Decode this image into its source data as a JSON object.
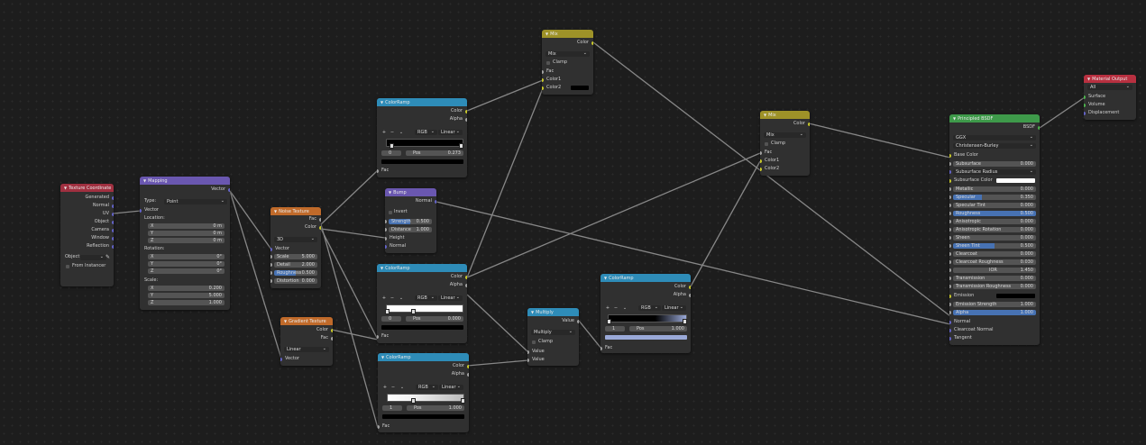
{
  "colors": {
    "texcoord": "#a03040",
    "mapping": "#6a57b0",
    "texture": "#c06a2a",
    "converter": "#2e8cb8",
    "shader": "#3e9a4a",
    "output": "#b83040",
    "bump": "#6a57b0"
  },
  "nodes": {
    "texcoord": {
      "title": "Texture Coordinate",
      "outputs": [
        "Generated",
        "Normal",
        "UV",
        "Object",
        "Camera",
        "Window",
        "Reflection"
      ],
      "object_label": "Object",
      "from_instancer": "From Instancer"
    },
    "mapping": {
      "title": "Mapping",
      "out": "Vector",
      "type_label": "Type:",
      "type_value": "Point",
      "vector_in": "Vector",
      "location_label": "Location:",
      "rotation_label": "Rotation:",
      "scale_label": "Scale:",
      "location": [
        [
          "X",
          "0 m"
        ],
        [
          "Y",
          "0 m"
        ],
        [
          "Z",
          "0 m"
        ]
      ],
      "rotation": [
        [
          "X",
          "0°"
        ],
        [
          "Y",
          "0°"
        ],
        [
          "Z",
          "0°"
        ]
      ],
      "scale": [
        [
          "X",
          "0.200"
        ],
        [
          "Y",
          "5.000"
        ],
        [
          "Z",
          "1.000"
        ]
      ]
    },
    "noise": {
      "title": "Noise Texture",
      "out_fac": "Fac",
      "out_color": "Color",
      "dim": "3D",
      "vector_in": "Vector",
      "fields": [
        [
          "Scale",
          "5.000"
        ],
        [
          "Detail",
          "2.000"
        ],
        [
          "Roughness",
          "0.500"
        ],
        [
          "Distortion",
          "0.000"
        ]
      ]
    },
    "gradient": {
      "title": "Gradient Texture",
      "out_color": "Color",
      "out_fac": "Fac",
      "interp": "Linear",
      "vector_in": "Vector"
    },
    "ramp1": {
      "title": "ColorRamp",
      "out_color": "Color",
      "out_alpha": "Alpha",
      "mode": "RGB",
      "interp": "Linear",
      "idx": "0",
      "pos_label": "Pos",
      "pos": "0.273",
      "fac_in": "Fac"
    },
    "bump": {
      "title": "Bump",
      "out": "Normal",
      "invert": "Invert",
      "fields": [
        [
          "Strength",
          "0.500"
        ],
        [
          "Distance",
          "1.000"
        ]
      ],
      "in_height": "Height",
      "in_normal": "Normal"
    },
    "ramp2": {
      "title": "ColorRamp",
      "out_color": "Color",
      "out_alpha": "Alpha",
      "mode": "RGB",
      "interp": "Linear",
      "idx": "0",
      "pos_label": "Pos",
      "pos": "0.000",
      "fac_in": "Fac"
    },
    "ramp3": {
      "title": "ColorRamp",
      "out_color": "Color",
      "out_alpha": "Alpha",
      "mode": "RGB",
      "interp": "Linear",
      "idx": "1",
      "pos_label": "Pos",
      "pos": "1.000",
      "fac_in": "Fac"
    },
    "mix1": {
      "title": "Mix",
      "out": "Color",
      "blend": "Mix",
      "clamp": "Clamp",
      "in_fac": "Fac",
      "in_c1": "Color1",
      "in_c2": "Color2"
    },
    "multiply": {
      "title": "Multiply",
      "out": "Value",
      "op": "Multiply",
      "clamp": "Clamp",
      "in_v1": "Value",
      "in_v2": "Value"
    },
    "ramp4": {
      "title": "ColorRamp",
      "out_color": "Color",
      "out_alpha": "Alpha",
      "mode": "RGB",
      "interp": "Linear",
      "idx": "1",
      "pos_label": "Pos",
      "pos": "1.000",
      "fac_in": "Fac"
    },
    "mix2": {
      "title": "Mix",
      "out": "Color",
      "blend": "Mix",
      "clamp": "Clamp",
      "in_fac": "Fac",
      "in_c1": "Color1",
      "in_c2": "Color2"
    },
    "bsdf": {
      "title": "Principled BSDF",
      "out": "BSDF",
      "dist": "GGX",
      "sss": "Christensen-Burley",
      "base_color": "Base Color",
      "subsurface_radius": "Subsurface Radius",
      "subsurface_color": "Subsurface Color",
      "emission": "Emission",
      "normal": "Normal",
      "clearcoat_normal": "Clearcoat Normal",
      "tangent": "Tangent",
      "fields": [
        [
          "Subsurface",
          "0.000"
        ],
        [
          "Metallic",
          "0.000"
        ],
        [
          "Specular",
          "0.350"
        ],
        [
          "Specular Tint",
          "0.000"
        ],
        [
          "Roughness",
          "0.500"
        ],
        [
          "Anisotropic",
          "0.000"
        ],
        [
          "Anisotropic Rotation",
          "0.000"
        ],
        [
          "Sheen",
          "0.000"
        ],
        [
          "Sheen Tint",
          "0.500"
        ],
        [
          "Clearcoat",
          "0.000"
        ],
        [
          "Clearcoat Roughness",
          "0.030"
        ],
        [
          "IOR",
          "1.450"
        ],
        [
          "Transmission",
          "0.000"
        ],
        [
          "Transmission Roughness",
          "0.000"
        ]
      ],
      "emission_strength": [
        "Emission Strength",
        "1.000"
      ],
      "alpha": [
        "Alpha",
        "1.000"
      ]
    },
    "output": {
      "title": "Material Output",
      "target": "All",
      "inputs": [
        "Surface",
        "Volume",
        "Displacement"
      ]
    }
  }
}
